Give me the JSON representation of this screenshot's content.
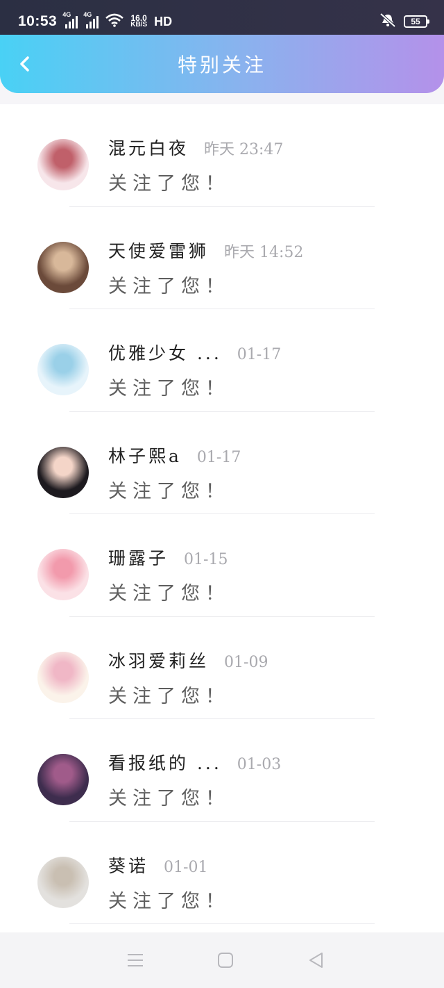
{
  "status_bar": {
    "time": "10:53",
    "net1": "4G",
    "net2": "4G",
    "speed_value": "16.0",
    "speed_unit": "KB/S",
    "hd": "HD",
    "battery": "55",
    "icons": [
      "signal-icon",
      "signal-icon",
      "wifi-icon",
      "mute-icon",
      "battery-icon"
    ]
  },
  "header": {
    "title": "特别关注",
    "back_icon": "chevron-left-icon",
    "colors": {
      "start": "#49d1f5",
      "middle": "#8ab2ee",
      "end": "#b491ea"
    }
  },
  "notifications": [
    {
      "name": "混元白夜",
      "time": "昨天 23:47",
      "message": "关注了您！",
      "avatar_colors": [
        "#f7e6ea",
        "#c0606a"
      ]
    },
    {
      "name": "天使爱雷狮",
      "time": "昨天 14:52",
      "message": "关注了您！",
      "avatar_colors": [
        "#6b4a3a",
        "#d8b89a"
      ]
    },
    {
      "name": "优雅少女 ...",
      "time": "01-17",
      "message": "关注了您！",
      "avatar_colors": [
        "#e7f4fb",
        "#9ad0e8"
      ]
    },
    {
      "name": "林子熙a",
      "time": "01-17",
      "message": "关注了您！",
      "avatar_colors": [
        "#1d1a1f",
        "#f4d5c8"
      ]
    },
    {
      "name": "珊露子",
      "time": "01-15",
      "message": "关注了您！",
      "avatar_colors": [
        "#fbe1e6",
        "#f29aac"
      ]
    },
    {
      "name": "冰羽爱莉丝",
      "time": "01-09",
      "message": "关注了您！",
      "avatar_colors": [
        "#fbf3ea",
        "#f0b7c6"
      ]
    },
    {
      "name": "看报纸的 ...",
      "time": "01-03",
      "message": "关注了您！",
      "avatar_colors": [
        "#3e2d4e",
        "#a05b8a"
      ]
    },
    {
      "name": "葵诺",
      "time": "01-01",
      "message": "关注了您！",
      "avatar_colors": [
        "#e3e1de",
        "#c9bfb2"
      ]
    }
  ],
  "nav_bar": {
    "menu_icon": "menu-icon",
    "home_icon": "home-square-icon",
    "back_icon": "back-triangle-icon"
  }
}
